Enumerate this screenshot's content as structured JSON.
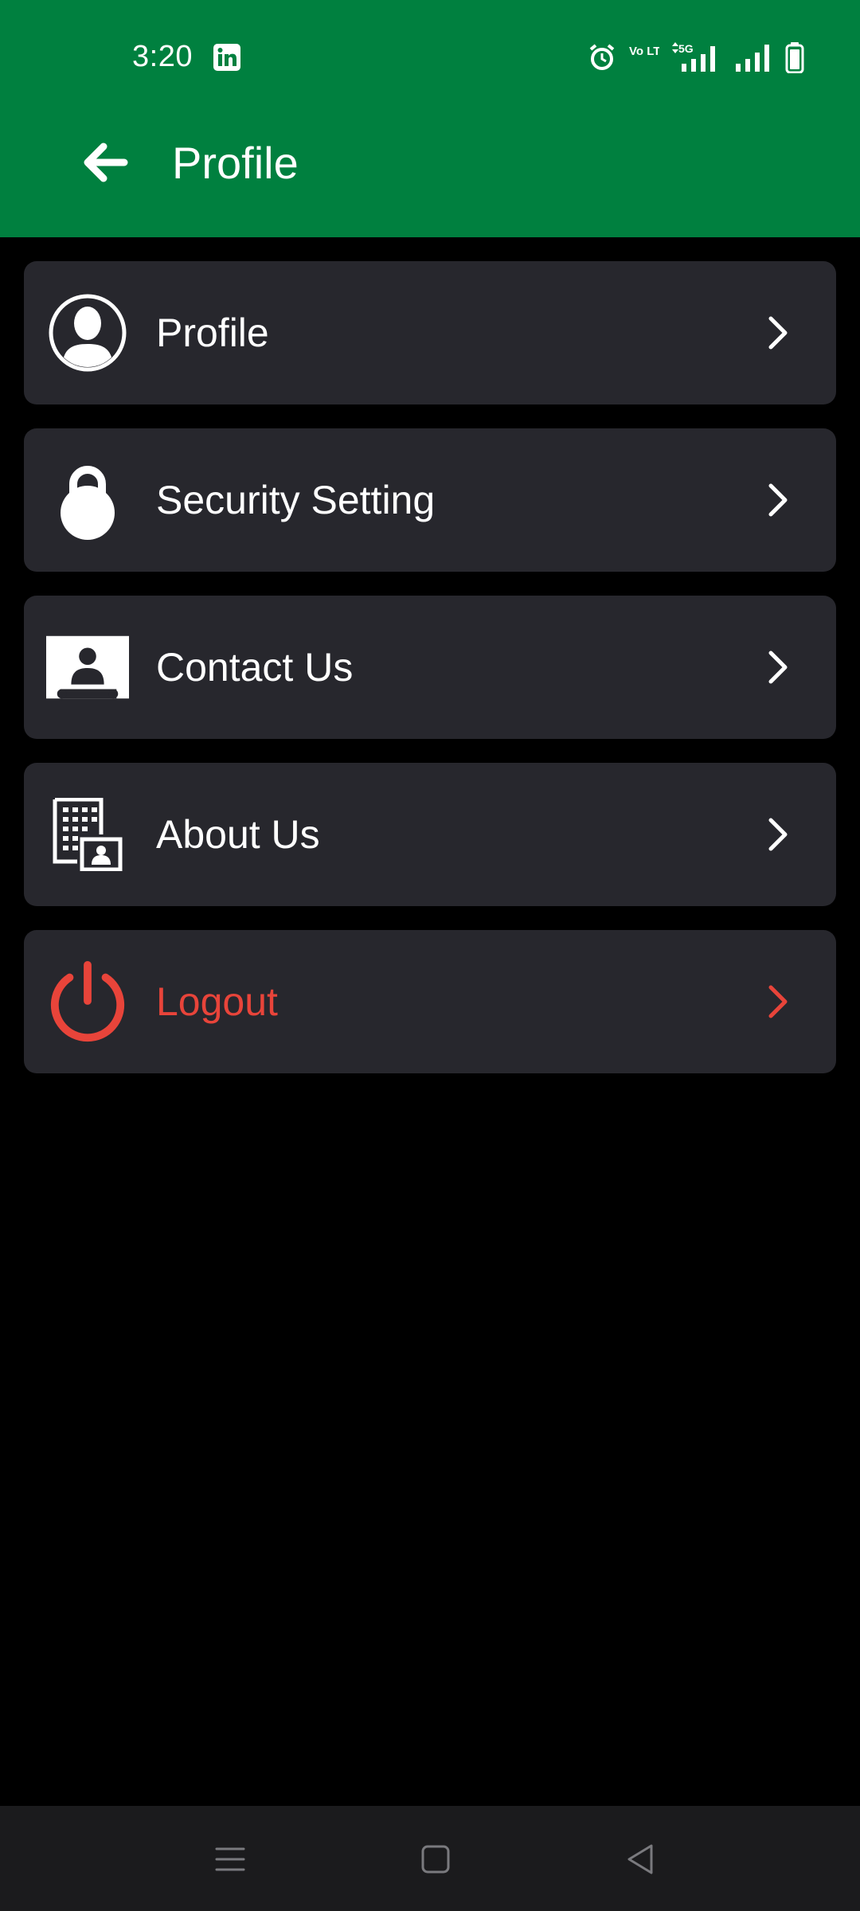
{
  "status_bar": {
    "time": "3:20",
    "icons": [
      "linkedin-icon",
      "alarm-icon",
      "volte-icon",
      "5g-signal-icon",
      "signal-icon",
      "battery-icon"
    ],
    "volte_label": "Vo LTED",
    "network_label": "5G"
  },
  "header": {
    "title": "Profile",
    "back_icon": "arrow-left-icon",
    "background_color": "#00803f"
  },
  "menu": {
    "items": [
      {
        "label": "Profile",
        "icon": "person-circle-icon"
      },
      {
        "label": "Security Setting",
        "icon": "lock-icon"
      },
      {
        "label": "Contact Us",
        "icon": "contact-card-icon"
      },
      {
        "label": "About Us",
        "icon": "building-info-icon"
      },
      {
        "label": "Logout",
        "icon": "power-icon",
        "color": "#e8443a"
      }
    ],
    "chevron_icon": "chevron-right-icon",
    "item_background": "#27272d"
  },
  "nav_bar": {
    "buttons": [
      "menu-icon",
      "home-square-icon",
      "back-triangle-icon"
    ]
  }
}
